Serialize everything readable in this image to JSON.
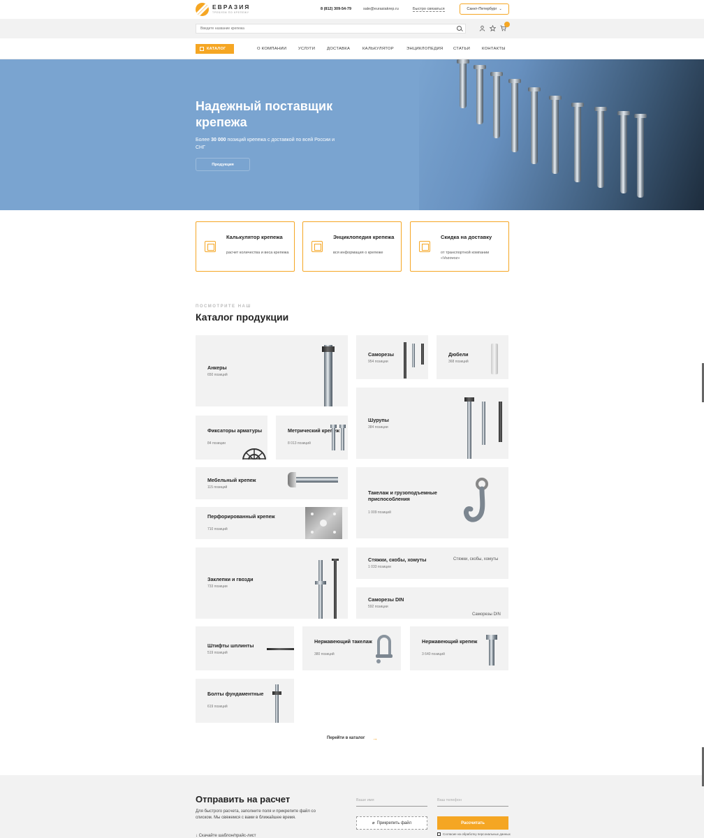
{
  "header": {
    "logo_name": "ЕВРАЗИЯ",
    "logo_sub": "ТРЕБУЕМ ПО КРЕПЕЖУ",
    "phone": "8 (812) 309-54-79",
    "email": "sale@eurasiakrep.ru",
    "quick_link": "Быстро связаться",
    "city": "Санкт-Петербург"
  },
  "search": {
    "placeholder": "Введите название крепежа"
  },
  "nav": {
    "catalog": "КАТАЛОГ",
    "items": [
      "О КОМПАНИИ",
      "УСЛУГИ",
      "ДОСТАВКА",
      "КАЛЬКУЛЯТОР",
      "ЭНЦИКЛОПЕДИЯ",
      "СТАТЬИ",
      "КОНТАКТЫ"
    ]
  },
  "hero": {
    "title": "Надежный поставщик крепежа",
    "sub_prefix": "Более ",
    "sub_bold": "30 000",
    "sub_suffix": " позиций крепежа с доставкой по всей России и СНГ",
    "button": "Продукция"
  },
  "features": [
    {
      "title": "Калькулятор крепежа",
      "text": "расчет количества и веса крепежа"
    },
    {
      "title": "Энциклопедия крепежа",
      "text": "вся информация о крепеже"
    },
    {
      "title": "Скидка на доставку",
      "text": "от транспортной компании «Vozovoz»"
    }
  ],
  "catalog": {
    "kicker": "ПОСМОТРИТЕ НАШ",
    "title": "Каталог продукции",
    "items": [
      {
        "name": "Анкеры",
        "count": "650 позиций"
      },
      {
        "name": "Саморезы",
        "count": "954 позиции"
      },
      {
        "name": "Дюбели",
        "count": "368 позиций"
      },
      {
        "name": "Фиксаторы арматуры",
        "count": "84 позиции"
      },
      {
        "name": "Метрический крепеж",
        "count": "8 013 позиций"
      },
      {
        "name": "Шурупы",
        "count": "384 позиции"
      },
      {
        "name": "Мебельный крепеж",
        "count": "115 позиций"
      },
      {
        "name": "Такелаж и грузоподъемные приспособления",
        "count": "1 009 позиций"
      },
      {
        "name": "Перфорированный крепеж",
        "count": "710 позиций"
      },
      {
        "name": "Заклепки и гвозди",
        "count": "733 позиции"
      },
      {
        "name": "Стяжки, скобы, хомуты",
        "count": "1 033 позиции"
      },
      {
        "name": "Саморезы DIN",
        "count": "592 позиции"
      },
      {
        "name": "Штифты шплинты",
        "count": "519 позиций"
      },
      {
        "name": "Нержавеющий такелаж",
        "count": "380 позиций"
      },
      {
        "name": "Нержавеющий крепеж",
        "count": "3 640 позиций"
      },
      {
        "name": "Болты фундаментные",
        "count": "619 позиций"
      }
    ],
    "alt_ties": "Стяжки, скобы, хомуты",
    "alt_din": "Саморезы DIN",
    "goto": "Перейти в каталог"
  },
  "form": {
    "title": "Отправить на расчет",
    "text": "Для быстрого расчета, заполните поля и прикрепите файл со списком. Мы свяжемся с вами в ближайшее время.",
    "link": "Скачайте шаблон/прайс-лист",
    "name_placeholder": "Ваше имя",
    "phone_placeholder": "Ваш телефон",
    "attach": "Прикрепить файл",
    "submit": "Рассчитать",
    "consent": "Согласие на обработку персональных данных"
  },
  "colors": {
    "accent": "#f5a623",
    "hero_bg": "#7aa4d0",
    "card_bg": "#f2f2f2"
  }
}
